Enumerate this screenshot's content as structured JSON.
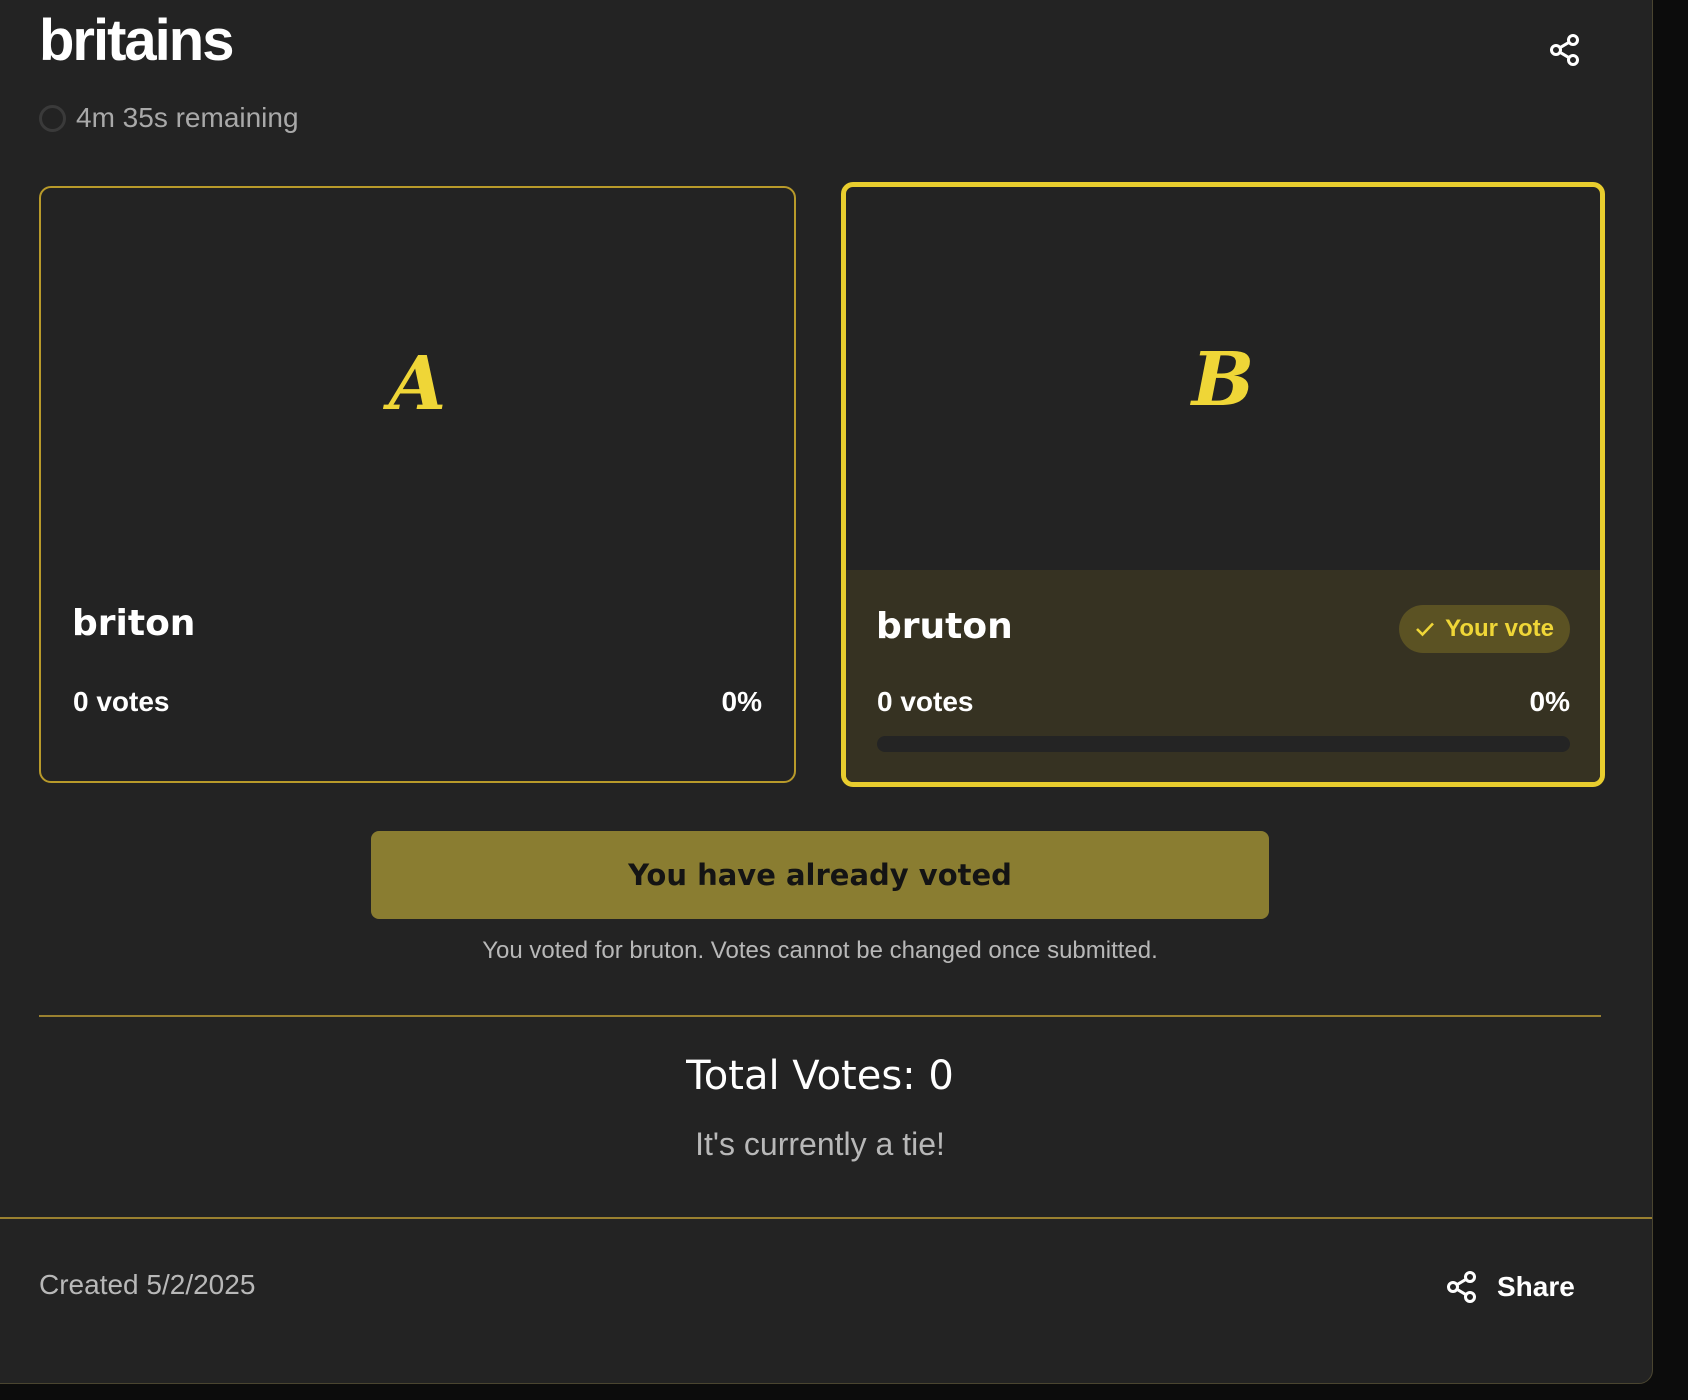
{
  "poll": {
    "title": "britains",
    "time_remaining": "4m 35s remaining"
  },
  "options": [
    {
      "letter": "A",
      "name": "briton",
      "votes": "0 votes",
      "percent": "0%",
      "share": 0
    },
    {
      "letter": "B",
      "name": "bruton",
      "votes": "0 votes",
      "percent": "0%",
      "share": 0,
      "badge": "Your vote"
    }
  ],
  "vote_status": {
    "button_label": "You have already voted",
    "note": "You voted for bruton. Votes cannot be changed once submitted."
  },
  "results": {
    "total": "Total Votes: 0",
    "summary": "It's currently a tie!"
  },
  "footer": {
    "created": "Created 5/2/2025",
    "share_label": "Share"
  },
  "icons": {
    "top_share": "share-icon",
    "footer_share": "share-icon",
    "badge": "check-icon",
    "timer": "timer-ring-icon"
  },
  "colors": {
    "accent": "#efd637",
    "button": "#8a7d31",
    "background": "#232323"
  }
}
